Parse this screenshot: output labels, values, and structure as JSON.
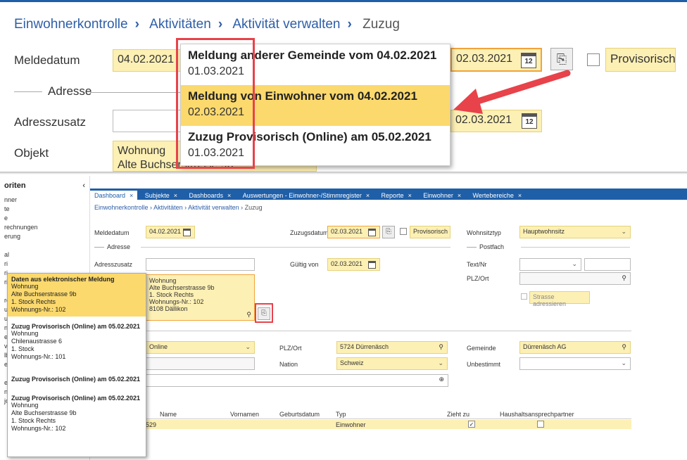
{
  "zoom": {
    "breadcrumb": [
      "Einwohnerkontrolle",
      "Aktivitäten",
      "Aktivität verwalten",
      "Zuzug"
    ],
    "meldedatum_label": "Meldedatum",
    "meldedatum_value": "04.02.2021",
    "zuzugsdatum_value": "02.03.2021",
    "provisorisch_label": "Provisorisch",
    "adresse_section": "Adresse",
    "adresszusatz_label": "Adresszusatz",
    "gueltig_value": "02.03.2021",
    "objekt_label": "Objekt",
    "objekt_line1": "Wohnung",
    "objekt_line2": "Alte Buchserstrasse 9b",
    "dropdown": [
      {
        "title": "Meldung anderer Gemeinde vom 04.02.2021",
        "date": "01.03.2021"
      },
      {
        "title": "Meldung von Einwohner vom 04.02.2021",
        "date": "02.03.2021"
      },
      {
        "title": "Zuzug Provisorisch (Online) am 05.02.2021",
        "date": "01.03.2021"
      }
    ]
  },
  "app": {
    "sidebar_title": "oriten",
    "sidebar_items": [
      "nner",
      "te",
      "e",
      "rechnungen",
      "erung",
      "",
      "al",
      "ri",
      "ri",
      "ri",
      "",
      "ro",
      "ud",
      "ur",
      "nr",
      "ei",
      "ve",
      "lb",
      "ert",
      "",
      "el",
      "nl",
      "jobs"
    ],
    "tabs": [
      "Dashboard",
      "Subjekte",
      "Dashboards",
      "Auswertungen - Einwohner-/Stimmregister",
      "Reporte",
      "Einwohner",
      "Wertebereiche"
    ],
    "breadcrumb": [
      "Einwohnerkontrolle",
      "Aktivitäten",
      "Aktivität verwalten",
      "Zuzug"
    ],
    "meldedatum_label": "Meldedatum",
    "meldedatum_value": "04.02.2021",
    "zuzugsdatum_label": "Zuzugsdatum",
    "zuzugsdatum_value": "02.03.2021",
    "provisorisch_label": "Provisorisch",
    "wohnsitztyp_label": "Wohnsitztyp",
    "wohnsitztyp_value": "Hauptwohnsitz",
    "adresse_section": "Adresse",
    "postfach_section": "Postfach",
    "adresszusatz_label": "Adresszusatz",
    "gueltig_label": "Gültig von",
    "gueltig_value": "02.03.2021",
    "textnr_label": "Text/Nr",
    "plzort_label": "PLZ/Ort",
    "strasse_label": "Strasse adressieren",
    "objekt_lines": [
      "Wohnung",
      "Alte Buchserstrasse 9b",
      "1. Stock Rechts",
      "Wohnungs-Nr.: 102",
      "8108 Dällikon"
    ],
    "herkunft_value": "Online",
    "plzort2_label": "PLZ/Ort",
    "plzort2_value": "5724 Dürrenäsch",
    "gemeinde_label": "Gemeinde",
    "gemeinde_value": "Dürrenäsch AG",
    "nation_label": "Nation",
    "nation_value": "Schweiz",
    "unbestimmt_label": "Unbestimmt",
    "grid_headers": [
      "Name",
      "Vornamen",
      "Geburtsdatum",
      "Typ",
      "Zieht zu",
      "Haushaltsansprechpartner"
    ],
    "grid_row": {
      "id": "529",
      "typ": "Einwohner"
    },
    "popup": [
      {
        "title": "Daten aus elektronischer Meldung",
        "lines": [
          "Wohnung",
          "Alte Buchserstrasse 9b",
          "1. Stock Rechts",
          "Wohnungs-Nr.: 102"
        ]
      },
      {
        "title": "Zuzug Provisorisch (Online) am 05.02.2021",
        "lines": [
          "Wohnung",
          "Chilenaustrasse 6",
          "1. Stock",
          "Wohnungs-Nr.: 101"
        ]
      },
      {
        "title": "Zuzug Provisorisch (Online) am 05.02.2021",
        "lines": []
      },
      {
        "title": "Zuzug Provisorisch (Online) am 05.02.2021",
        "lines": [
          "Wohnung",
          "Alte Buchserstrasse 9b",
          "1. Stock Rechts",
          "Wohnungs-Nr.: 102"
        ]
      }
    ]
  },
  "colors": {
    "accent": "#1f5fa8",
    "field": "#fdf0b4",
    "selected": "#fbd96d",
    "highlight": "#e8424a"
  }
}
